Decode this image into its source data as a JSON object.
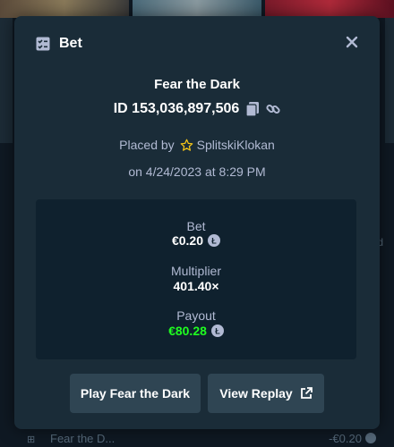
{
  "modal": {
    "title": "Bet",
    "game": "Fear the Dark",
    "bet_id": "ID 153,036,897,506",
    "placed_by_label": "Placed by",
    "username": "SplitskiKlokan",
    "date": "on 4/24/2023 at 8:29 PM",
    "stats": {
      "bet_label": "Bet",
      "bet_value": "€0.20",
      "multiplier_label": "Multiplier",
      "multiplier_value": "401.40×",
      "payout_label": "Payout",
      "payout_value": "€80.28"
    },
    "buttons": {
      "play": "Play Fear the Dark",
      "replay": "View Replay"
    }
  },
  "background": {
    "row_game": "Fear the D...",
    "row_amount": "-€0.20",
    "side_letter": "d"
  },
  "colors": {
    "modal_bg": "#1a2c38",
    "panel_bg": "#0f212e",
    "button_bg": "#2f4553",
    "payout_green": "#1fff20",
    "star_yellow": "#f5c518",
    "muted_text": "#b1bad3"
  },
  "icons": {
    "header": "bet-slip-icon",
    "close": "close-icon",
    "copy": "copy-icon",
    "link": "link-icon",
    "vip": "star-icon",
    "currency": "coin-icon",
    "external": "external-link-icon"
  }
}
